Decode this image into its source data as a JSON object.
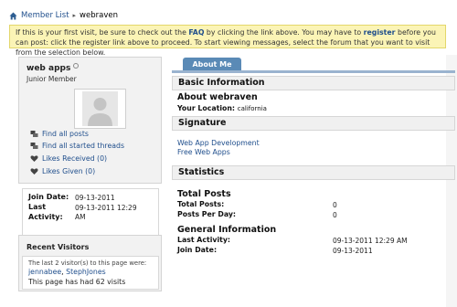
{
  "breadcrumb": {
    "home_icon": "home-icon",
    "member_list": "Member List",
    "current": "webraven"
  },
  "notice": {
    "part1": "If this is your first visit, be sure to check out the ",
    "faq": "FAQ",
    "part2": " by clicking the link above. You may have to ",
    "register": "register",
    "part3": " before you can post: click the register link above to proceed. To start viewing messages, select the forum that you want to visit from the selection below."
  },
  "profile": {
    "username": "web apps",
    "user_title": "Junior Member",
    "links": [
      {
        "label": "Find all posts",
        "icon": "posts-icon"
      },
      {
        "label": "Find all started threads",
        "icon": "threads-icon"
      },
      {
        "label": "Likes Received (0)",
        "icon": "heart-icon"
      },
      {
        "label": "Likes Given (0)",
        "icon": "heart-icon"
      }
    ],
    "info": {
      "join_label": "Join Date:",
      "join_value": "09-13-2011",
      "last_label_1": "Last",
      "last_label_2": "Activity:",
      "last_value_1": "09-13-2011 12:29",
      "last_value_2": "AM"
    }
  },
  "visitors": {
    "title": "Recent Visitors",
    "intro": "The last 2 visitor(s) to this page were:",
    "names": [
      "jennabee",
      "StephJones"
    ],
    "separator": ",",
    "visits": "This page has had 62 visits"
  },
  "main": {
    "tab": "About Me",
    "basic_info": {
      "header": "Basic Information",
      "about_title": "About webraven",
      "location_label": "Your Location:",
      "location_value": "california"
    },
    "signature": {
      "header": "Signature",
      "lines": [
        "Web App Development",
        "Free Web Apps"
      ]
    },
    "statistics": {
      "header": "Statistics",
      "total_posts_title": "Total Posts",
      "total_posts_label": "Total Posts:",
      "total_posts_value": "0",
      "posts_per_day_label": "Posts Per Day:",
      "posts_per_day_value": "0",
      "general_title": "General Information",
      "last_activity_label": "Last Activity:",
      "last_activity_value": "09-13-2011 12:29 AM",
      "join_label": "Join Date:",
      "join_value": "09-13-2011"
    }
  },
  "colors": {
    "link": "#1f4e8c",
    "tab": "#5a8ab6",
    "notice_bg": "#fbf4b6"
  }
}
